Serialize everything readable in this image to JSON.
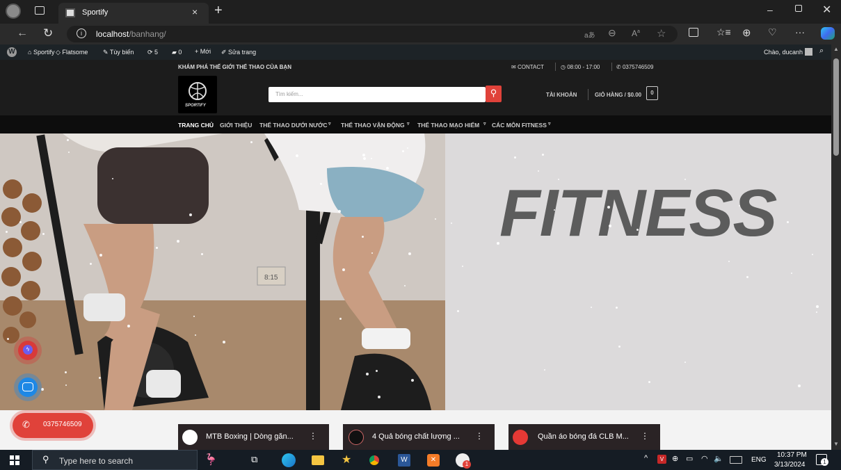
{
  "browser": {
    "tab_title": "Sportify",
    "url_host": "localhost",
    "url_path": "/banhang/",
    "toolbar_icons": [
      "read-aloud-icon",
      "zoom-icon",
      "text-icon",
      "favorite-icon",
      "split-screen-icon",
      "favorites-list-icon",
      "collections-icon",
      "heart-pulse-icon",
      "more-icon",
      "copilot-icon"
    ]
  },
  "wpbar": {
    "site": "Sportify",
    "theme": "Flatsome",
    "customize": "Tùy biến",
    "updates": "5",
    "comments": "0",
    "new": "Mới",
    "edit": "Sửa trang",
    "greeting": "Chào, ducanh"
  },
  "site": {
    "tagline": "KHÁM PHÁ THẾ GIỚI THỂ THAO CỦA BẠN",
    "contact": "CONTACT",
    "hours": "08:00 - 17:00",
    "phone": "0375746509",
    "logo_text": "SPORTIFY",
    "search_placeholder": "Tìm kiếm...",
    "account": "TÀI KHOẢN",
    "cart": "GIỎ HÀNG / $0.00",
    "cart_count": "0",
    "menu": [
      {
        "label": "TRANG CHỦ"
      },
      {
        "label": "GIỚI THIỆU"
      },
      {
        "label": "THỂ THAO DƯỚI NƯỚC"
      },
      {
        "label": "THỂ THAO VẬN ĐỘNG"
      },
      {
        "label": "THỂ THAO MẠO HIỂM"
      },
      {
        "label": "CÁC MÔN FITNESS"
      }
    ],
    "hero_title": "FITNESS",
    "float_phone": "0375746509",
    "cards": [
      {
        "title": "MTB Boxing | Dòng găn..."
      },
      {
        "title": "4 Quả bóng chất lượng ..."
      },
      {
        "title": "Quần áo bóng đá CLB M..."
      }
    ]
  },
  "taskbar": {
    "search_placeholder": "Type here to search",
    "lang": "ENG",
    "time": "10:37 PM",
    "date": "3/13/2024",
    "notification_count": "1"
  },
  "colors": {
    "accent": "#e0423a",
    "messenger": "#d83a3a",
    "zalo": "#1e88e5"
  }
}
